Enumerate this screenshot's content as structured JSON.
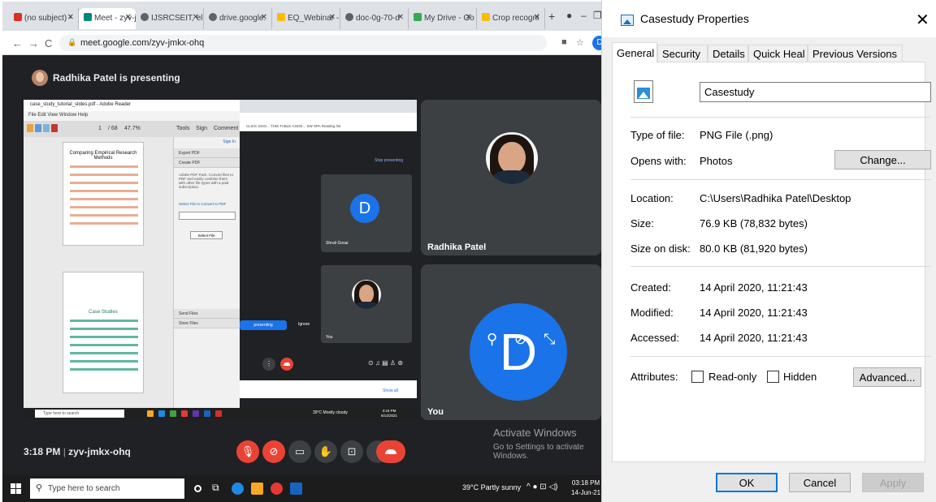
{
  "browser": {
    "tabs": [
      {
        "label": "(no subject) - ",
        "color": "#d93025"
      },
      {
        "label": "Meet - zyv-jm",
        "color": "#00897b"
      },
      {
        "label": "IJSRCSEIT, ell",
        "color": "#5f6368"
      },
      {
        "label": "drive.google.",
        "color": "#5f6368"
      },
      {
        "label": "EQ_Webinar - ",
        "color": "#fbbc04"
      },
      {
        "label": "doc-0g-70-d",
        "color": "#5f6368"
      },
      {
        "label": "My Drive - Go",
        "color": "#34a853"
      },
      {
        "label": "Crop recogni",
        "color": "#fbbc04"
      }
    ],
    "new_tab": "+",
    "url": "meet.google.com/zyv-jmkx-ohq",
    "profile_initial": "D"
  },
  "meet": {
    "presenting_text": "Radhika Patel is presenting",
    "meeting_time": "3:18 PM",
    "separator": "|",
    "meeting_code": "zyv-jmkx-ohq",
    "participants": [
      {
        "name": "Radhika Patel"
      },
      {
        "name": "You"
      }
    ],
    "activate_title": "Activate Windows",
    "activate_sub": "Go to Settings to activate Windows."
  },
  "shared_screen": {
    "reader_title": "case_study_tutorial_slides.pdf - Adobe Reader",
    "reader_menu": "File  Edit  View  Window  Help",
    "tools_labels": [
      "Tools",
      "Sign",
      "Comment"
    ],
    "tooltip": "Maximize",
    "page_number": "1",
    "page_total": "/ 68",
    "zoom": "47.7%",
    "page1_title": "Comparing Empirical Research Methods",
    "page2_title": "Case Studies",
    "pane_items": [
      "Sign In",
      "Export PDF",
      "Create PDF",
      "Send Files",
      "Store Files"
    ],
    "pane_text": "Adobe PDF Pack. Convert files to PDF and easily combine them with other file types with a paid subscription.",
    "pane_link": "Select File to Convert to PDF",
    "pane_button": "Select File",
    "inner_bookmarks": "CLICK GOO...   THIS TABLE CODE...   SW   SPA   Reading list",
    "stop_presenting": "Stop presenting",
    "inner_participant": "Shruti Gosai",
    "inner_you": "You",
    "inner_d": "D",
    "present_label": "presenting",
    "ignore_label": "Ignore",
    "show_all": "Show all",
    "inner_weather": "39°C  Mostly cloudy",
    "inner_clock_time": "3:18 PM",
    "inner_clock_date": "6/14/2021",
    "mini_search": "Type here to search"
  },
  "taskbar": {
    "search_placeholder": "Type here to search",
    "weather": "39°C  Partly sunny",
    "clock_time": "03:18 PM",
    "clock_date": "14-Jun-21"
  },
  "dialog": {
    "title": "Casestudy Properties",
    "close_glyph": "✕",
    "tabs": [
      "General",
      "Security",
      "Details",
      "Quick Heal",
      "Previous Versions"
    ],
    "active_tab": "General",
    "file_name": "Casestudy",
    "type_label": "Type of file:",
    "type_value": "PNG File (.png)",
    "opens_label": "Opens with:",
    "opens_value": "Photos",
    "change_button": "Change...",
    "location_label": "Location:",
    "location_value": "C:\\Users\\Radhika Patel\\Desktop",
    "size_label": "Size:",
    "size_value": "76.9 KB (78,832 bytes)",
    "size_disk_label": "Size on disk:",
    "size_disk_value": "80.0 KB (81,920 bytes)",
    "created_label": "Created:",
    "created_value": "14 April 2020, 11:21:43",
    "modified_label": "Modified:",
    "modified_value": "14 April 2020, 11:21:43",
    "accessed_label": "Accessed:",
    "accessed_value": "14 April 2020, 11:21:43",
    "attributes_label": "Attributes:",
    "readonly_label": "Read-only",
    "hidden_label": "Hidden",
    "advanced_button": "Advanced...",
    "ok_button": "OK",
    "cancel_button": "Cancel",
    "apply_button": "Apply"
  },
  "colors": {
    "meet_bg": "#202124",
    "tile_bg": "#3c4043",
    "accent_blue": "#1a73e8",
    "end_call_red": "#ea4335",
    "dialog_bg": "#f0f0f0",
    "focus_blue": "#0078d7"
  }
}
